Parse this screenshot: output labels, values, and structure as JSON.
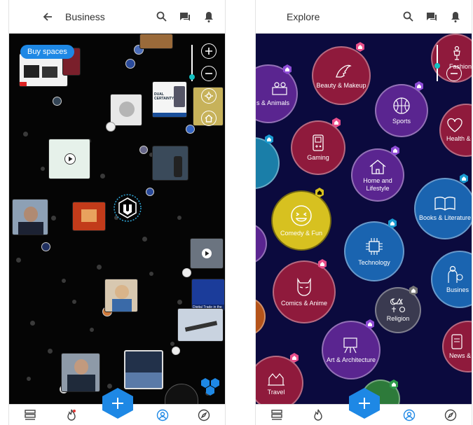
{
  "left_screen": {
    "appbar": {
      "title": "Business"
    },
    "buy_spaces_label": "Buy spaces",
    "poster_text": "DUAL CERTAINTY:",
    "thumb_label": "Digital Trade in the",
    "bottom_nav": [
      "stack",
      "flame",
      "profile",
      "compass"
    ]
  },
  "right_screen": {
    "appbar": {
      "title": "Explore"
    },
    "categories": [
      "Fashion",
      "Beauty & Makeup",
      "s & Animals",
      "Sports",
      "Health &",
      "Gaming",
      "Home and Lifestyle",
      "Books & Literature",
      "Comedy & Fun",
      "Technology",
      "Busines",
      "Comics & Anime",
      "Religion",
      "Art & Architecture",
      "News &",
      "Travel"
    ]
  },
  "colors": {
    "accent": "#1e88e5",
    "left_bg": "#050505",
    "right_bg": "#0b0a3e",
    "bubble_red": "#8f1a3c",
    "bubble_purple": "#5a2590",
    "bubble_blue": "#1a64b0",
    "bubble_yellow": "#d7c120",
    "badge_pink": "#e84f8a",
    "badge_purple": "#8f4dd6"
  }
}
